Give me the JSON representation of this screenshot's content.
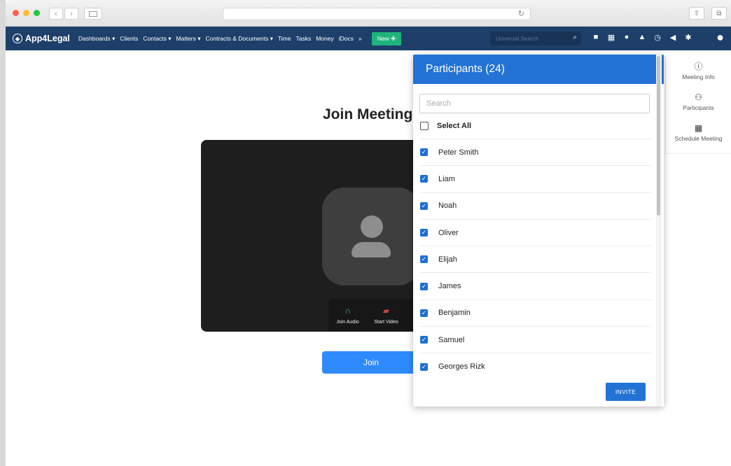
{
  "app": {
    "name": "App4Legal",
    "menu": [
      "Dashboards ▾",
      "Clients",
      "Contacts ▾",
      "Matters ▾",
      "Contracts & Documents ▾",
      "Time",
      "Tasks",
      "Money",
      "iDocs",
      "»"
    ],
    "new_label": "New ✚",
    "search_placeholder": "Universal Search"
  },
  "meeting": {
    "title": "Join Meeting",
    "join_audio": "Join Audio",
    "start_video": "Start Video",
    "join_label": "Join"
  },
  "sidepanel": {
    "items": [
      {
        "label": "Meeting Info",
        "icon": "help-circle-icon"
      },
      {
        "label": "Participants",
        "icon": "people-icon"
      },
      {
        "label": "Schedule Meeting",
        "icon": "calendar-icon"
      }
    ]
  },
  "participants": {
    "title": "Participants (24)",
    "search_placeholder": "Search",
    "select_all": "Select All",
    "list": [
      "Peter Smith",
      "Liam",
      "Noah",
      "Oliver",
      "Elijah",
      "James",
      "Benjamin",
      "Samuel",
      "Georges Rizk"
    ],
    "invite_label": "INVITE"
  },
  "colors": {
    "navbar": "#1e3f6a",
    "primary": "#2373d6",
    "join": "#2e8bff",
    "new_button": "#1fb57a"
  }
}
